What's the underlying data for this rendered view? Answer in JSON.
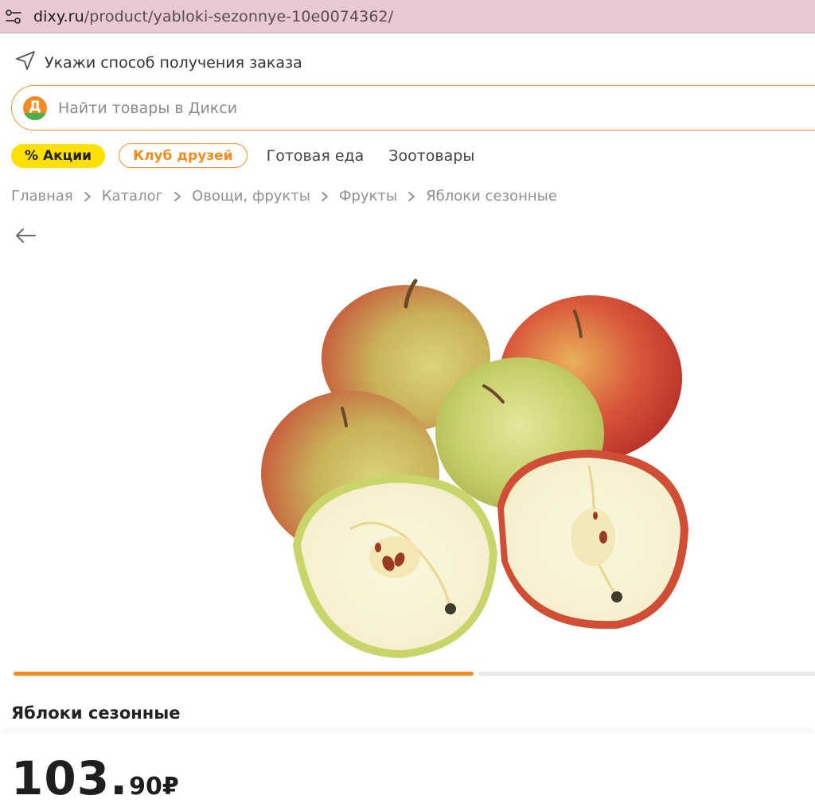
{
  "browser": {
    "url_host": "dixy.ru",
    "url_path": "/product/yabloki-sezonnye-10e0074362/"
  },
  "header": {
    "delivery_text": "Укажи способ получения заказа",
    "search_placeholder": "Найти товары в Дикси",
    "logo_letter": "Д"
  },
  "nav": {
    "promo_label": "% Акции",
    "club_label": "Клуб друзей",
    "links": [
      "Готовая еда",
      "Зоотовары"
    ]
  },
  "breadcrumbs": [
    "Главная",
    "Каталог",
    "Овощи, фрукты",
    "Фрукты",
    "Яблоки сезонные"
  ],
  "gallery": {
    "current_slide": 1,
    "total_slides": 2
  },
  "product": {
    "title": "Яблоки сезонные",
    "price_integer": "103",
    "price_separator": ".",
    "price_fraction": "90",
    "currency": "₽"
  },
  "colors": {
    "accent": "#f28c22",
    "promo_yellow": "#ffe000",
    "logo_green": "#4cae4f",
    "address_bar": "#e8c9d2"
  }
}
